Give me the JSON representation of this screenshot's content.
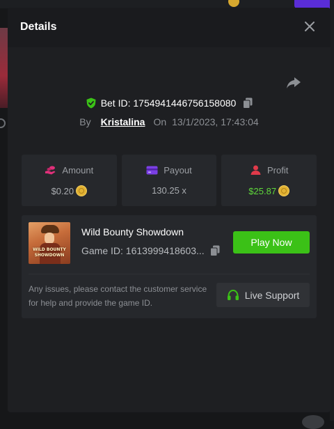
{
  "modal": {
    "title": "Details"
  },
  "bet": {
    "bet_id_label": "Bet ID: 1754941446756158080",
    "by_label": "By",
    "user": "Kristalina",
    "on_label": "On",
    "datetime": "13/1/2023, 17:43:04"
  },
  "stats": {
    "amount": {
      "label": "Amount",
      "value": "$0.20"
    },
    "payout": {
      "label": "Payout",
      "value": "130.25 x"
    },
    "profit": {
      "label": "Profit",
      "value": "$25.87"
    }
  },
  "game": {
    "name": "Wild Bounty Showdown",
    "id_text": "Game ID: 1613999418603...",
    "thumb_line1": "WILD BOUNTY",
    "thumb_line2": "SHOWDOWN",
    "play_label": "Play Now"
  },
  "support": {
    "help_text": "Any issues, please contact the customer service for help and provide the game ID.",
    "button_label": "Live Support"
  },
  "colors": {
    "accent_green": "#3bc117",
    "profit_green": "#5fd93b",
    "amount_icon": "#e0307a",
    "payout_icon": "#7b3fe4",
    "profit_icon": "#e03a4a",
    "coin": "#e2b233"
  },
  "icons": {
    "close": "close-icon",
    "share": "share-icon",
    "verified": "shield-check-icon",
    "copy": "copy-icon",
    "amount": "coins-hand-icon",
    "payout": "wallet-icon",
    "profit": "profit-user-icon",
    "support": "headset-icon"
  }
}
